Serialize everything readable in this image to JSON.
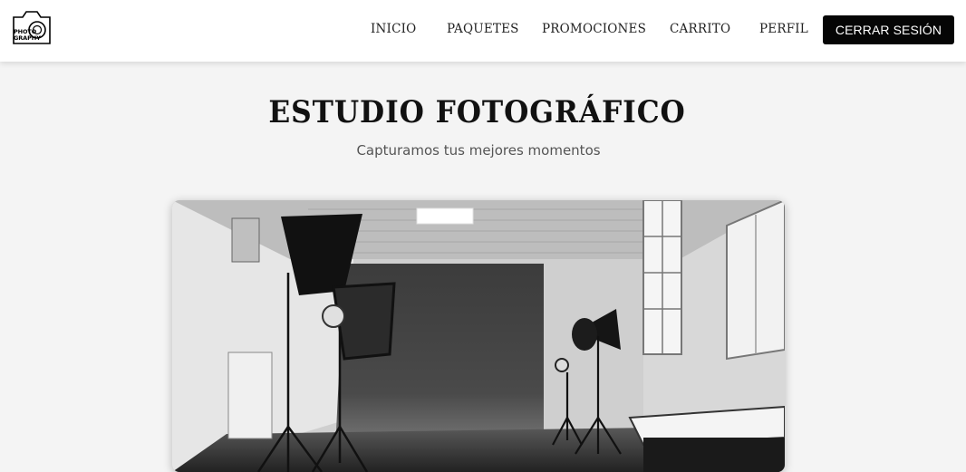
{
  "brand": {
    "logo_line1": "PHOTO",
    "logo_line2": "GRAPHY"
  },
  "nav": {
    "items": [
      {
        "label": "INICIO"
      },
      {
        "label": "PAQUETES"
      },
      {
        "label": "PROMOCIONES"
      },
      {
        "label": "CARRITO"
      },
      {
        "label": "PERFIL"
      }
    ],
    "logout_label": "CERRAR SESIÓN"
  },
  "hero": {
    "title": "ESTUDIO FOTOGRÁFICO",
    "subtitle": "Capturamos tus mejores momentos"
  },
  "colors": {
    "page_background": "#f4f4f4",
    "header_background": "#ffffff",
    "button_background": "#050505",
    "button_text": "#ffffff"
  }
}
